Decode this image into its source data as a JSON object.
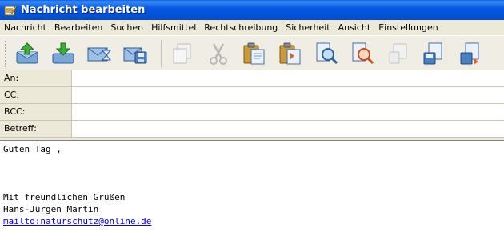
{
  "window": {
    "title": "Nachricht bearbeiten",
    "title_color": "#0055e5"
  },
  "menu": [
    "Nachricht",
    "Bearbeiten",
    "Suchen",
    "Hilfsmittel",
    "Rechtschreibung",
    "Sicherheit",
    "Ansicht",
    "Einstellungen"
  ],
  "toolbar": {
    "buttons": [
      {
        "icon": "send-icon",
        "enabled": true
      },
      {
        "icon": "save-download-icon",
        "enabled": true
      },
      {
        "icon": "send-later-icon",
        "enabled": true
      },
      {
        "icon": "save-disk-icon",
        "enabled": true
      },
      {
        "icon": "copy-icon",
        "enabled": false
      },
      {
        "icon": "cut-scissors-icon",
        "enabled": false
      },
      {
        "icon": "paste-icon",
        "enabled": true
      },
      {
        "icon": "paste-quote-icon",
        "enabled": true
      },
      {
        "icon": "find-icon",
        "enabled": true
      },
      {
        "icon": "replace-icon",
        "enabled": true
      },
      {
        "icon": "attach-disabled-icon",
        "enabled": false
      },
      {
        "icon": "save-as-icon",
        "enabled": true
      },
      {
        "icon": "export-icon",
        "enabled": true
      }
    ]
  },
  "headers": {
    "to_label": "An:",
    "to_value": "",
    "cc_label": "CC:",
    "cc_value": "",
    "bcc_label": "BCC:",
    "bcc_value": "",
    "subject_label": "Betreff:",
    "subject_value": ""
  },
  "body": {
    "lines": [
      "Guten Tag ,",
      "",
      "",
      "",
      "Mit freundlichen Grüßen",
      "Hans-Jürgen Martin"
    ],
    "link": "mailto:naturschutz@online.de"
  }
}
